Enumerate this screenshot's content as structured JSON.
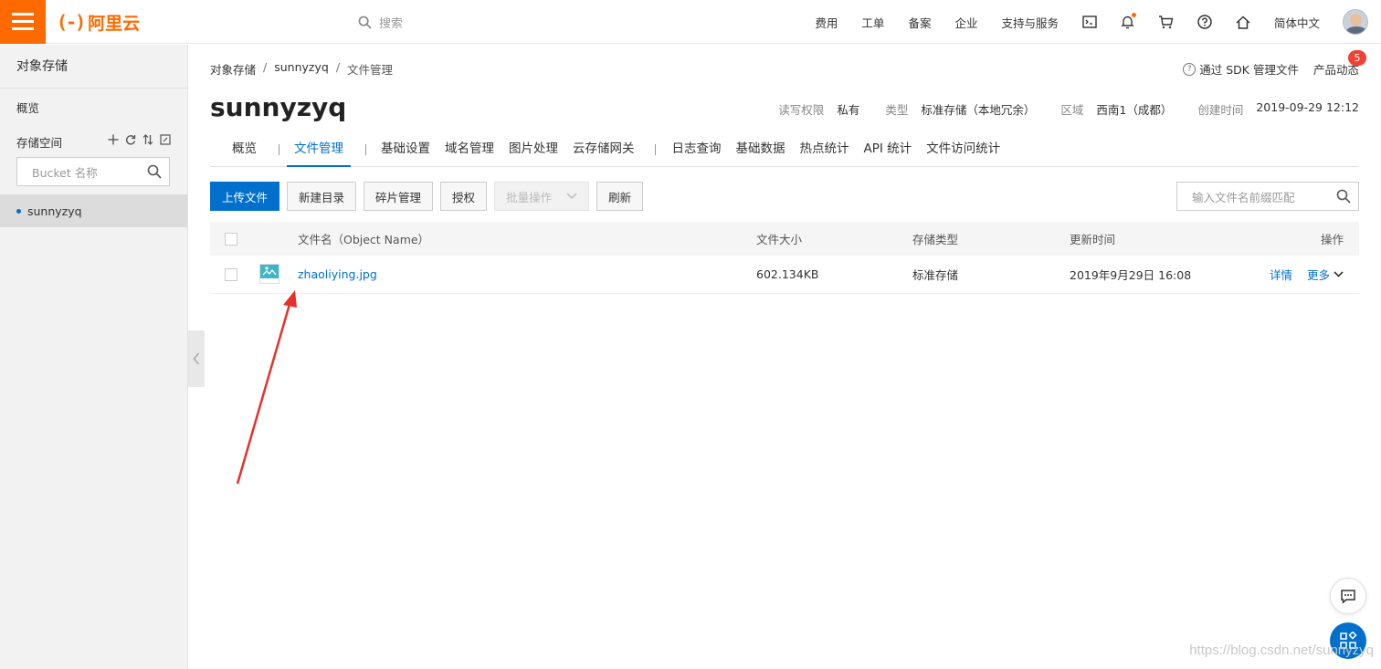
{
  "topbar": {
    "logo_mark": "(-)",
    "logo_text": "阿里云",
    "search_placeholder": "搜索",
    "nav": [
      "费用",
      "工单",
      "备案",
      "企业",
      "支持与服务"
    ],
    "language": "简体中文"
  },
  "sidebar": {
    "title": "对象存储",
    "overview": "概览",
    "space_label": "存储空间",
    "bucket_search_placeholder": "Bucket 名称",
    "buckets": [
      "sunnyzyq"
    ]
  },
  "breadcrumb": [
    "对象存储",
    "sunnyzyq",
    "文件管理"
  ],
  "top_links": {
    "sdk": "通过 SDK 管理文件",
    "product": "产品动态",
    "product_badge": "5"
  },
  "bucket": {
    "name": "sunnyzyq",
    "meta": [
      {
        "k": "读写权限",
        "v": "私有"
      },
      {
        "k": "类型",
        "v": "标准存储（本地冗余）"
      },
      {
        "k": "区域",
        "v": "西南1（成都）"
      },
      {
        "k": "创建时间",
        "v": "2019-09-29 12:12"
      }
    ]
  },
  "tabs": [
    "概览",
    "文件管理",
    "基础设置",
    "域名管理",
    "图片处理",
    "云存储网关",
    "日志查询",
    "基础数据",
    "热点统计",
    "API 统计",
    "文件访问统计"
  ],
  "toolbar": {
    "upload": "上传文件",
    "new_dir": "新建目录",
    "fragments": "碎片管理",
    "authorize": "授权",
    "batch": "批量操作",
    "refresh": "刷新",
    "file_search_placeholder": "输入文件名前缀匹配"
  },
  "table": {
    "headers": {
      "name": "文件名（Object Name）",
      "size": "文件大小",
      "type": "存储类型",
      "time": "更新时间",
      "op": "操作"
    },
    "rows": [
      {
        "name": "zhaoliying.jpg",
        "size": "602.134KB",
        "type": "标准存储",
        "time": "2019年9月29日 16:08",
        "detail": "详情",
        "more": "更多"
      }
    ]
  },
  "watermark": "https://blog.csdn.net/sunnyzyq",
  "colors": {
    "brand": "#ff6a00",
    "primary": "#0070cc",
    "annotation": "#e8302a"
  }
}
